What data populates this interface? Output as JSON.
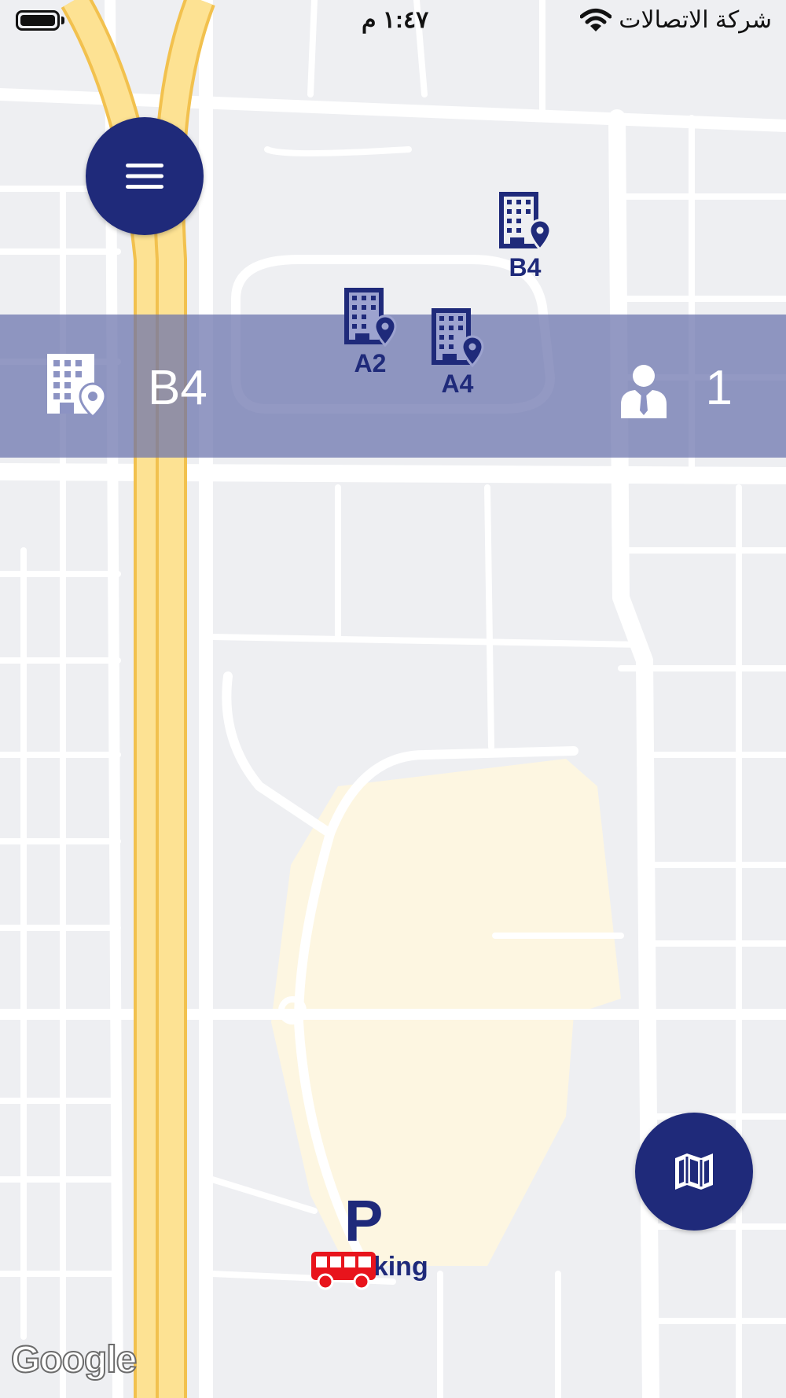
{
  "status_bar": {
    "time": "١:٤٧ م",
    "carrier": "شركة الاتصالات",
    "wifi_icon": "wifi-icon",
    "battery_icon": "battery-icon"
  },
  "menu_button": {
    "icon": "hamburger-menu-icon"
  },
  "map_button": {
    "icon": "map-icon"
  },
  "banner": {
    "building_icon": "building-location-icon",
    "selected_building": "B4",
    "person_icon": "person-icon",
    "count": "1"
  },
  "markers": [
    {
      "label": "B4",
      "icon": "building-location-icon"
    },
    {
      "label": "A2",
      "icon": "building-location-icon"
    },
    {
      "label": "A4",
      "icon": "building-location-icon"
    }
  ],
  "parking": {
    "symbol": "P",
    "label": "Parking",
    "icon": "bus-icon"
  },
  "map_attribution": "Google",
  "colors": {
    "primary": "#1f2a7a",
    "banner": "#6971ac",
    "highway": "#fde293",
    "map_background": "#eeeff2",
    "area_fill": "#fdf6e1",
    "bus": "#e8141c"
  }
}
